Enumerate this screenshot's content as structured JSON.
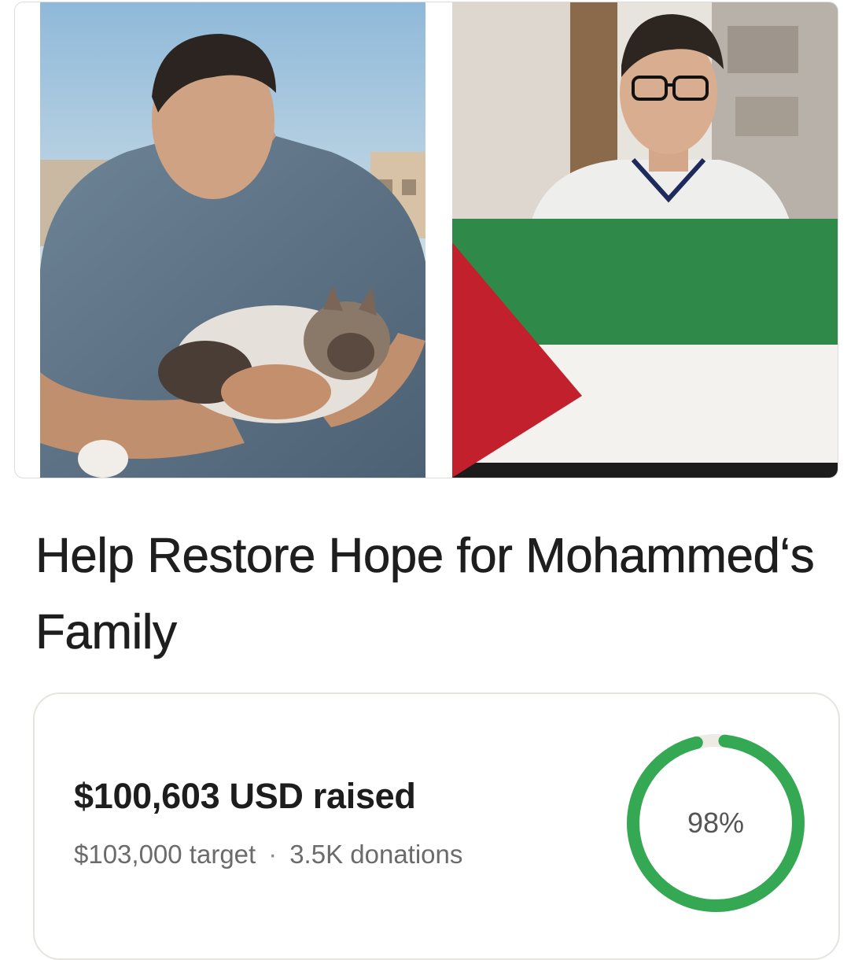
{
  "photos": [
    {
      "name": "young-man-holding-cat-photo"
    },
    {
      "name": "boy-holding-palestinian-flag-photo"
    }
  ],
  "campaign": {
    "title": "Help Restore Hope for Mohammed‘s Family",
    "raised_text": "$100,603 USD raised",
    "target_text": "$103,000 target",
    "separator": "·",
    "donations_text": "3.5K donations",
    "progress_label": "98%",
    "progress_fraction": 0.98
  },
  "colors": {
    "progress_fill": "#34a853",
    "progress_track": "#ecebe6",
    "title_text": "#1e1e1e",
    "muted_text": "#6b6b6b"
  }
}
